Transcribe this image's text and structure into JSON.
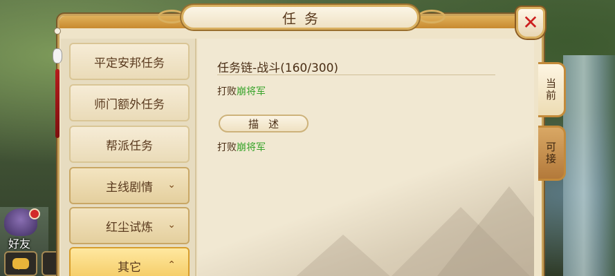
{
  "window": {
    "title": "任务",
    "close_label": "✕"
  },
  "hud": {
    "friend_label": "好友",
    "friend_icon": "friend-avatar-icon",
    "chat_icon": "chat-icon"
  },
  "sidebar": {
    "items": [
      {
        "label": "平定安邦任务",
        "type": "item"
      },
      {
        "label": "师门额外任务",
        "type": "item"
      },
      {
        "label": "帮派任务",
        "type": "item"
      },
      {
        "label": "主线剧情",
        "type": "group",
        "chevron": "⌄"
      },
      {
        "label": "红尘试炼",
        "type": "group",
        "chevron": "⌄"
      },
      {
        "label": "其它",
        "type": "group-active",
        "chevron": "⌃"
      }
    ]
  },
  "quest": {
    "title": "任务链-战斗(160/300)",
    "objective_prefix": "打败",
    "objective_target": "崩将军",
    "description_header": "描述",
    "description_prefix": "打败",
    "description_target": "崩将军"
  },
  "tabs": {
    "current": "当前",
    "accept": "可接"
  },
  "colors": {
    "target_text": "#37a32a",
    "close_x": "#cc1f1f",
    "active_category": "#f3c85e"
  }
}
